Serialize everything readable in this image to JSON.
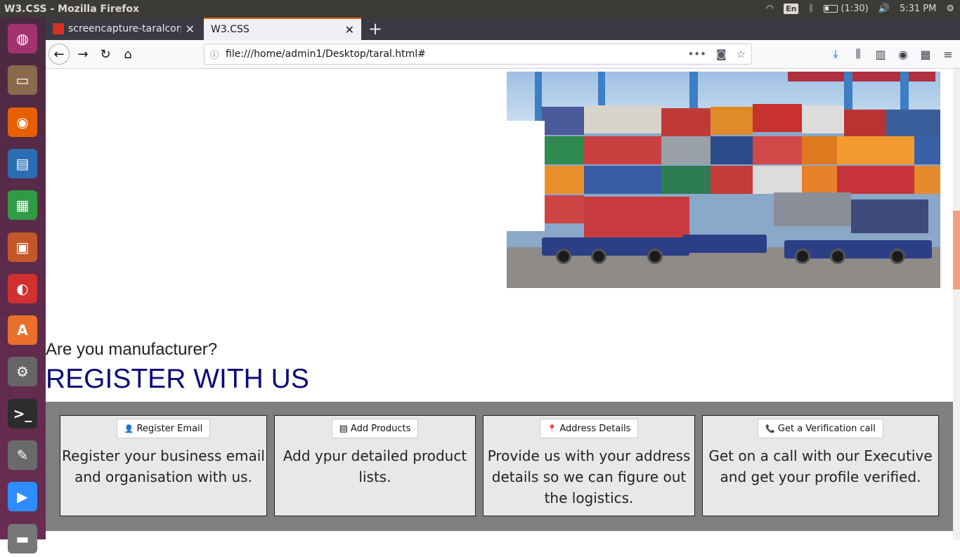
{
  "system": {
    "window_title": "W3.CSS - Mozilla Firefox",
    "lang": "En",
    "battery": "(1:30)",
    "clock": "5:31 PM"
  },
  "launcher": {
    "items": [
      {
        "name": "ubuntu-dash-icon",
        "color": "#a3336f"
      },
      {
        "name": "files-icon",
        "color": "#8a6a4a"
      },
      {
        "name": "firefox-icon",
        "color": "#e66000"
      },
      {
        "name": "writer-icon",
        "color": "#2a6db3"
      },
      {
        "name": "calc-icon",
        "color": "#2f9b45"
      },
      {
        "name": "impress-icon",
        "color": "#c4572a"
      },
      {
        "name": "document-viewer-icon",
        "color": "#d03030"
      },
      {
        "name": "software-center-icon",
        "color": "#e8702c"
      },
      {
        "name": "settings-icon",
        "color": "#666"
      },
      {
        "name": "terminal-icon",
        "color": "#2c2c2c"
      },
      {
        "name": "text-editor-icon",
        "color": "#6a6a6a"
      },
      {
        "name": "zoom-icon",
        "color": "#2d8cff"
      },
      {
        "name": "drive-icon",
        "color": "#777"
      }
    ]
  },
  "browser": {
    "tabs": [
      {
        "label": "screencapture-taralcorp",
        "close": "✕"
      },
      {
        "label": "W3.CSS",
        "close": "✕"
      }
    ],
    "new_tab": "+",
    "url": "file:///home/admin1/Desktop/taral.html#"
  },
  "page": {
    "question": "Are you manufacturer?",
    "heading": "REGISTER WITH US",
    "cards": [
      {
        "button": "Register Email",
        "icon": "user-icon",
        "glyph": "👤",
        "text": "Register your business email and organisation with us."
      },
      {
        "button": "Add Products",
        "icon": "list-icon",
        "glyph": "▤",
        "text": "Add ypur detailed product lists."
      },
      {
        "button": "Address Details",
        "icon": "map-marker-icon",
        "glyph": "📍",
        "text": "Provide us with your address details so we can figure out the logistics."
      },
      {
        "button": "Get a Verification call",
        "icon": "phone-icon",
        "glyph": "📞",
        "text": "Get on a call with our Executive and get your profile verified."
      }
    ]
  }
}
